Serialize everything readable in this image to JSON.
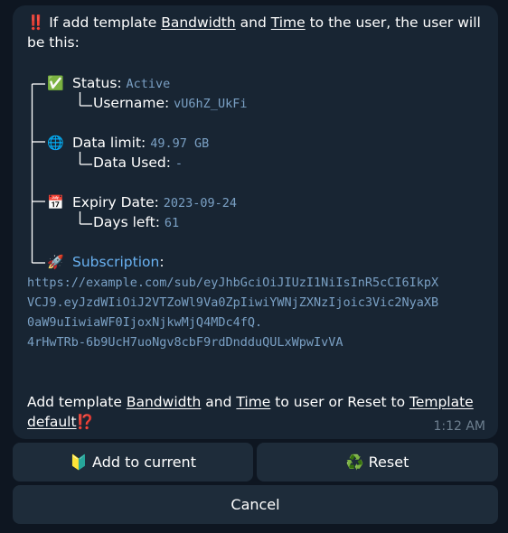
{
  "message": {
    "intro_prefix": "‼️ If add template ",
    "intro_bandwidth": "Bandwidth",
    "intro_and": " and ",
    "intro_time": "Time",
    "intro_suffix": " to the user, the user will",
    "intro_line2": "be this:",
    "status_label": "Status: ",
    "status_value": "Active",
    "username_label": "Username: ",
    "username_value": "vU6hZ_UkFi",
    "data_limit_label": "Data limit: ",
    "data_limit_value": "49.97 GB",
    "data_used_label": "Data Used: ",
    "data_used_value": "-",
    "expiry_label": "Expiry Date: ",
    "expiry_value": "2023-09-24",
    "days_left_label": "Days left: ",
    "days_left_value": "61",
    "subscription_label": "Subscription",
    "subscription_colon": ":",
    "sub_url_lines": [
      "https://example.com/sub/eyJhbGciOiJIUzI1NiIsInR5cCI6IkpX",
      "VCJ9.eyJzdWIiOiJ2VTZoWl9Va0ZpIiwiYWNjZXNzIjoic3Vic2NyaXB",
      "0aW9uIiwiaWF0IjoxNjkwMjQ4MDc4fQ.",
      "4rHwTRb-6b9UcH7uoNgv8cbF9rdDndduQULxWpwIvVA"
    ],
    "footer_prefix": "Add template ",
    "footer_bandwidth": "Bandwidth",
    "footer_and": " and ",
    "footer_time": "Time",
    "footer_mid": " to user or Reset to ",
    "footer_template": "Template",
    "footer_default": "default",
    "footer_emoji": "⁉️",
    "time": "1:12 AM"
  },
  "icons": {
    "status": "check-mark-icon",
    "data_limit": "globe-icon",
    "expiry": "calendar-icon",
    "subscription": "rocket-icon"
  },
  "buttons": {
    "add_to_current": "🔰 Add to current",
    "reset": "♻️ Reset",
    "cancel": "Cancel"
  }
}
